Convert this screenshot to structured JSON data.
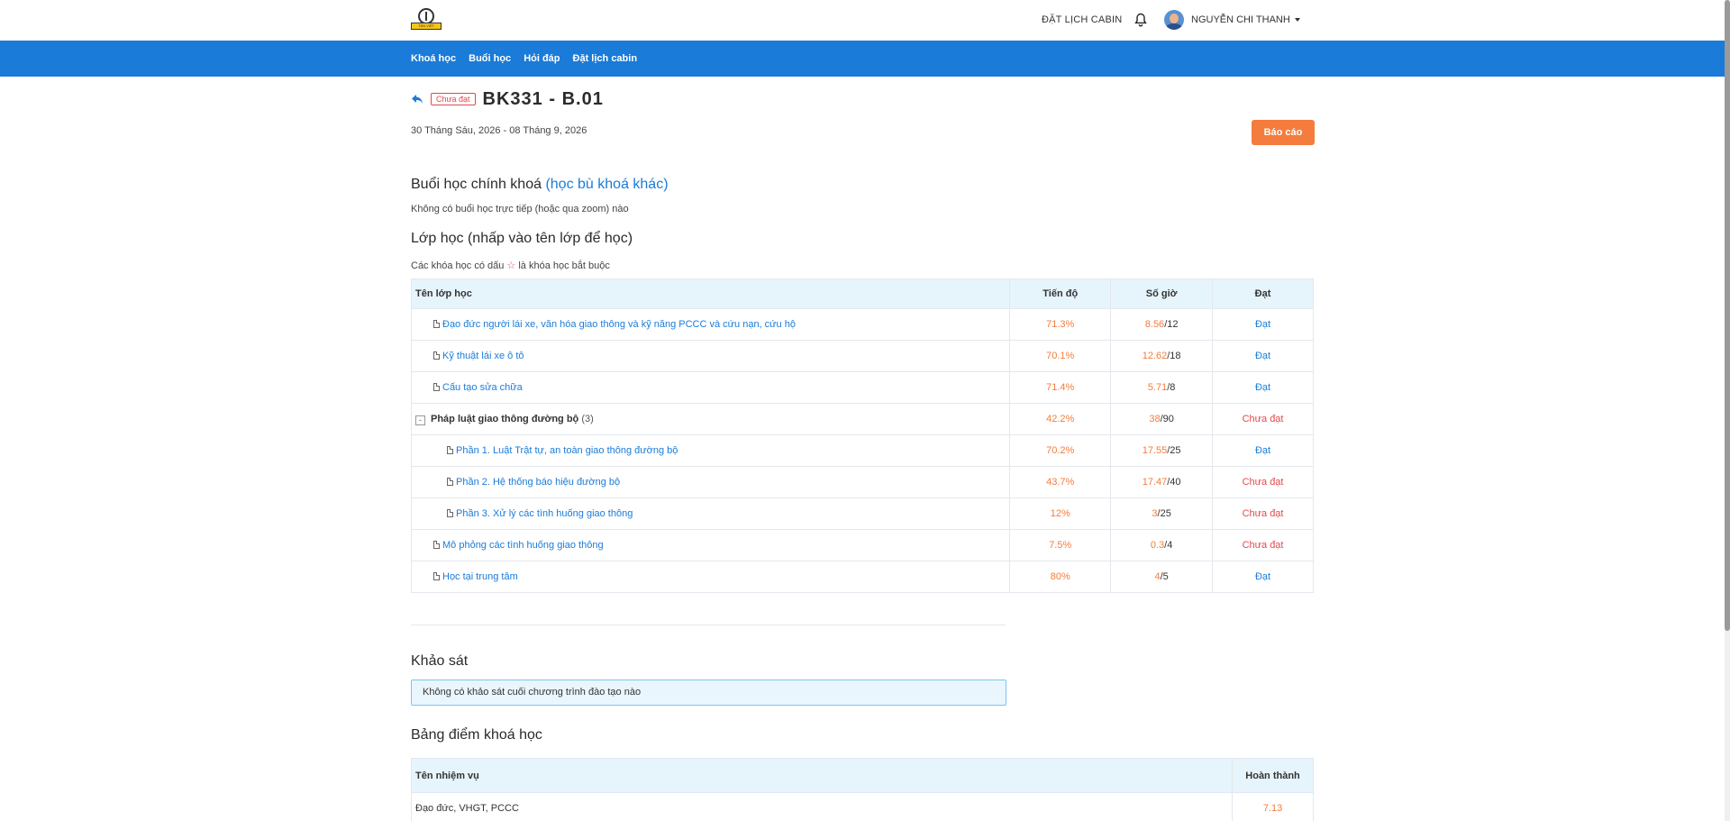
{
  "header": {
    "logo_text": "TÂN VIỆT",
    "book_cabin": "ĐẶT LỊCH CABIN",
    "user_name": "NGUYỄN CHI THANH"
  },
  "nav": {
    "items": [
      "Khoá học",
      "Buổi học",
      "Hỏi đáp",
      "Đặt lịch cabin"
    ]
  },
  "course": {
    "status_badge": "Chưa đạt",
    "title": "BK331 - B.01",
    "date_range": "30 Tháng Sáu, 2026 - 08 Tháng 9, 2026",
    "report_button": "Báo cáo"
  },
  "sessions": {
    "heading": "Buổi học chính khoá",
    "heading_link": "(học bù khoá khác)",
    "empty_text": "Không có buổi học trực tiếp (hoặc qua zoom) nào"
  },
  "classes": {
    "heading": "Lớp học (nhấp vào tên lớp để học)",
    "note_before": "Các khóa học có dấu",
    "note_star": "☆",
    "note_after": "là khóa học bắt buộc",
    "columns": [
      "Tên lớp học",
      "Tiến độ",
      "Số giờ",
      "Đạt"
    ],
    "rows": [
      {
        "name": "Đạo đức người lái xe, văn hóa giao thông và kỹ năng PCCC và cứu nạn, cứu hộ",
        "progress": "71.3%",
        "hours_done": "8.56",
        "hours_total": "/12",
        "result": "Đạt"
      },
      {
        "name": "Kỹ thuật lái xe ô tô",
        "progress": "70.1%",
        "hours_done": "12.62",
        "hours_total": "/18",
        "result": "Đạt"
      },
      {
        "name": "Cấu tạo sửa chữa",
        "progress": "71.4%",
        "hours_done": "5.71",
        "hours_total": "/8",
        "result": "Đạt"
      },
      {
        "name": "Pháp luật giao thông đường bộ",
        "count": "(3)",
        "toggle": "-",
        "progress": "42.2%",
        "hours_done": "38",
        "hours_total": "/90",
        "result": "Chưa đạt"
      },
      {
        "name": "Phần 1. Luật Trật tự, an toàn giao thông đường bộ",
        "progress": "70.2%",
        "hours_done": "17.55",
        "hours_total": "/25",
        "result": "Đạt"
      },
      {
        "name": "Phần 2. Hệ thống báo hiệu đường bộ",
        "progress": "43.7%",
        "hours_done": "17.47",
        "hours_total": "/40",
        "result": "Chưa đạt"
      },
      {
        "name": "Phần 3. Xử lý các tình huống giao thông",
        "progress": "12%",
        "hours_done": "3",
        "hours_total": "/25",
        "result": "Chưa đạt"
      },
      {
        "name": "Mô phỏng các tình huống giao thông",
        "progress": "7.5%",
        "hours_done": "0.3",
        "hours_total": "/4",
        "result": "Chưa đạt"
      },
      {
        "name": "Học tại trung tâm",
        "progress": "80%",
        "hours_done": "4",
        "hours_total": "/5",
        "result": "Đạt"
      }
    ]
  },
  "survey": {
    "heading": "Khảo sát",
    "empty_text": "Không có khảo sát cuối chương trình đào tạo nào"
  },
  "scores": {
    "heading": "Bảng điểm khoá học",
    "columns": [
      "Tên nhiệm vụ",
      "Hoàn thành"
    ],
    "rows": [
      {
        "name": "Đạo đức, VHGT, PCCC",
        "value": "7.13"
      }
    ]
  },
  "colors": {
    "primary": "#1a7bd8",
    "accent": "#f47c3c",
    "danger": "#e5484d",
    "table_header": "#e6f4fc"
  }
}
